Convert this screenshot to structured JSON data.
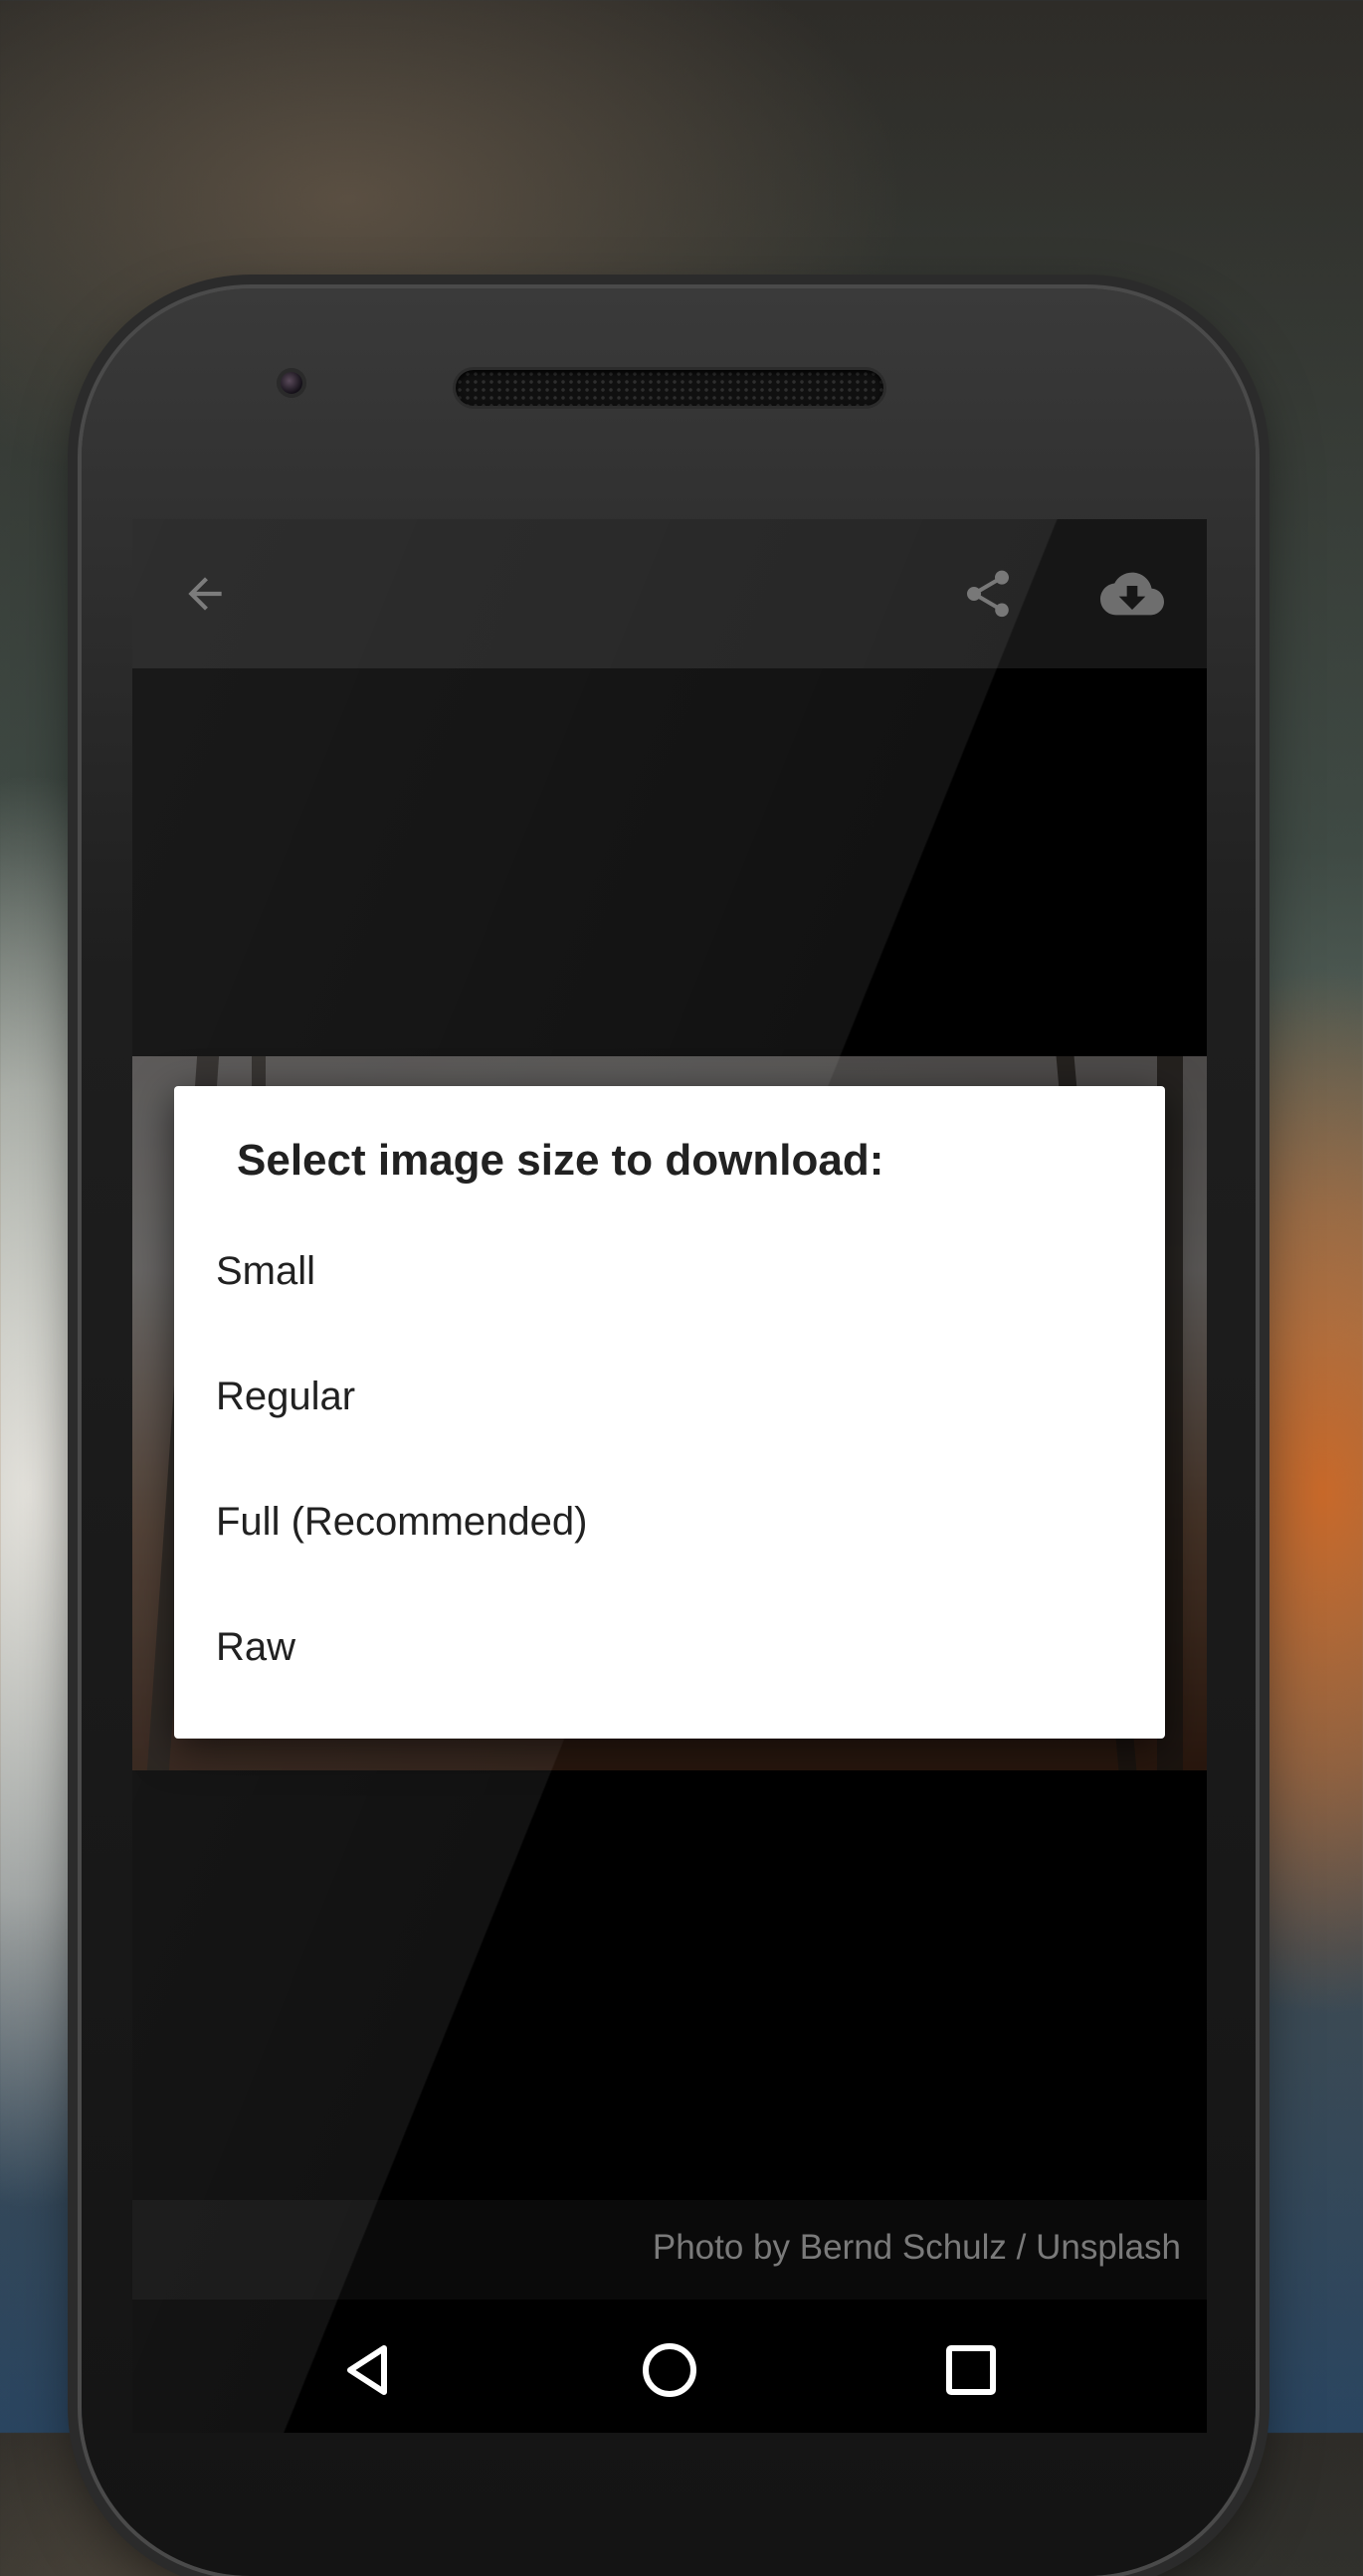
{
  "toolbar": {
    "back_icon": "arrow-back-icon",
    "share_icon": "share-icon",
    "download_icon": "cloud-download-icon"
  },
  "dialog": {
    "title": "Select image size to download:",
    "options": [
      {
        "label": "Small"
      },
      {
        "label": "Regular"
      },
      {
        "label": "Full (Recommended)"
      },
      {
        "label": "Raw"
      }
    ]
  },
  "photo": {
    "credit": "Photo by Bernd Schulz / Unsplash"
  },
  "navbar": {
    "back_icon": "nav-back-icon",
    "home_icon": "nav-home-icon",
    "recents_icon": "nav-recents-icon"
  },
  "colors": {
    "dialog_background": "#ffffff",
    "toolbar_background": "#161616",
    "text_primary": "#212121",
    "caption_text": "#7a7a7a"
  }
}
